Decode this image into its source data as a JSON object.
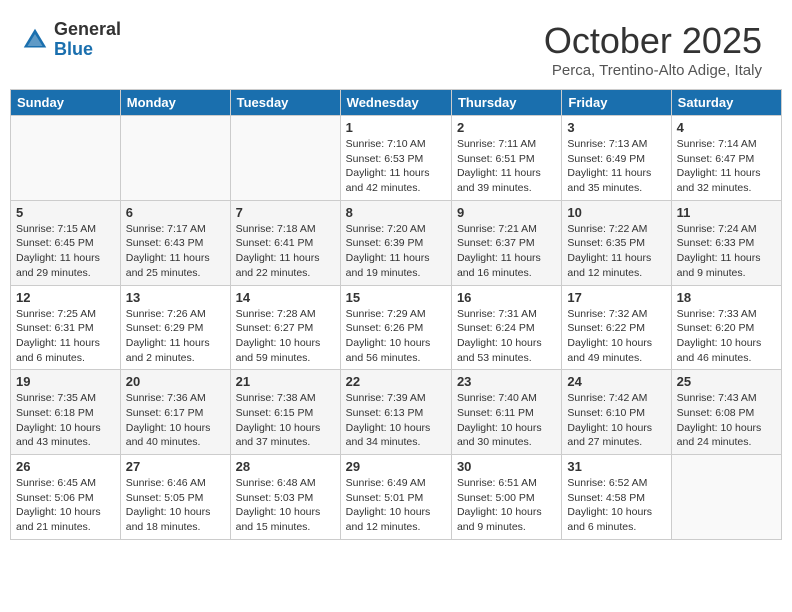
{
  "header": {
    "logo_general": "General",
    "logo_blue": "Blue",
    "month_title": "October 2025",
    "subtitle": "Perca, Trentino-Alto Adige, Italy"
  },
  "weekdays": [
    "Sunday",
    "Monday",
    "Tuesday",
    "Wednesday",
    "Thursday",
    "Friday",
    "Saturday"
  ],
  "weeks": [
    [
      {
        "day": "",
        "info": ""
      },
      {
        "day": "",
        "info": ""
      },
      {
        "day": "",
        "info": ""
      },
      {
        "day": "1",
        "info": "Sunrise: 7:10 AM\nSunset: 6:53 PM\nDaylight: 11 hours and 42 minutes."
      },
      {
        "day": "2",
        "info": "Sunrise: 7:11 AM\nSunset: 6:51 PM\nDaylight: 11 hours and 39 minutes."
      },
      {
        "day": "3",
        "info": "Sunrise: 7:13 AM\nSunset: 6:49 PM\nDaylight: 11 hours and 35 minutes."
      },
      {
        "day": "4",
        "info": "Sunrise: 7:14 AM\nSunset: 6:47 PM\nDaylight: 11 hours and 32 minutes."
      }
    ],
    [
      {
        "day": "5",
        "info": "Sunrise: 7:15 AM\nSunset: 6:45 PM\nDaylight: 11 hours and 29 minutes."
      },
      {
        "day": "6",
        "info": "Sunrise: 7:17 AM\nSunset: 6:43 PM\nDaylight: 11 hours and 25 minutes."
      },
      {
        "day": "7",
        "info": "Sunrise: 7:18 AM\nSunset: 6:41 PM\nDaylight: 11 hours and 22 minutes."
      },
      {
        "day": "8",
        "info": "Sunrise: 7:20 AM\nSunset: 6:39 PM\nDaylight: 11 hours and 19 minutes."
      },
      {
        "day": "9",
        "info": "Sunrise: 7:21 AM\nSunset: 6:37 PM\nDaylight: 11 hours and 16 minutes."
      },
      {
        "day": "10",
        "info": "Sunrise: 7:22 AM\nSunset: 6:35 PM\nDaylight: 11 hours and 12 minutes."
      },
      {
        "day": "11",
        "info": "Sunrise: 7:24 AM\nSunset: 6:33 PM\nDaylight: 11 hours and 9 minutes."
      }
    ],
    [
      {
        "day": "12",
        "info": "Sunrise: 7:25 AM\nSunset: 6:31 PM\nDaylight: 11 hours and 6 minutes."
      },
      {
        "day": "13",
        "info": "Sunrise: 7:26 AM\nSunset: 6:29 PM\nDaylight: 11 hours and 2 minutes."
      },
      {
        "day": "14",
        "info": "Sunrise: 7:28 AM\nSunset: 6:27 PM\nDaylight: 10 hours and 59 minutes."
      },
      {
        "day": "15",
        "info": "Sunrise: 7:29 AM\nSunset: 6:26 PM\nDaylight: 10 hours and 56 minutes."
      },
      {
        "day": "16",
        "info": "Sunrise: 7:31 AM\nSunset: 6:24 PM\nDaylight: 10 hours and 53 minutes."
      },
      {
        "day": "17",
        "info": "Sunrise: 7:32 AM\nSunset: 6:22 PM\nDaylight: 10 hours and 49 minutes."
      },
      {
        "day": "18",
        "info": "Sunrise: 7:33 AM\nSunset: 6:20 PM\nDaylight: 10 hours and 46 minutes."
      }
    ],
    [
      {
        "day": "19",
        "info": "Sunrise: 7:35 AM\nSunset: 6:18 PM\nDaylight: 10 hours and 43 minutes."
      },
      {
        "day": "20",
        "info": "Sunrise: 7:36 AM\nSunset: 6:17 PM\nDaylight: 10 hours and 40 minutes."
      },
      {
        "day": "21",
        "info": "Sunrise: 7:38 AM\nSunset: 6:15 PM\nDaylight: 10 hours and 37 minutes."
      },
      {
        "day": "22",
        "info": "Sunrise: 7:39 AM\nSunset: 6:13 PM\nDaylight: 10 hours and 34 minutes."
      },
      {
        "day": "23",
        "info": "Sunrise: 7:40 AM\nSunset: 6:11 PM\nDaylight: 10 hours and 30 minutes."
      },
      {
        "day": "24",
        "info": "Sunrise: 7:42 AM\nSunset: 6:10 PM\nDaylight: 10 hours and 27 minutes."
      },
      {
        "day": "25",
        "info": "Sunrise: 7:43 AM\nSunset: 6:08 PM\nDaylight: 10 hours and 24 minutes."
      }
    ],
    [
      {
        "day": "26",
        "info": "Sunrise: 6:45 AM\nSunset: 5:06 PM\nDaylight: 10 hours and 21 minutes."
      },
      {
        "day": "27",
        "info": "Sunrise: 6:46 AM\nSunset: 5:05 PM\nDaylight: 10 hours and 18 minutes."
      },
      {
        "day": "28",
        "info": "Sunrise: 6:48 AM\nSunset: 5:03 PM\nDaylight: 10 hours and 15 minutes."
      },
      {
        "day": "29",
        "info": "Sunrise: 6:49 AM\nSunset: 5:01 PM\nDaylight: 10 hours and 12 minutes."
      },
      {
        "day": "30",
        "info": "Sunrise: 6:51 AM\nSunset: 5:00 PM\nDaylight: 10 hours and 9 minutes."
      },
      {
        "day": "31",
        "info": "Sunrise: 6:52 AM\nSunset: 4:58 PM\nDaylight: 10 hours and 6 minutes."
      },
      {
        "day": "",
        "info": ""
      }
    ]
  ]
}
